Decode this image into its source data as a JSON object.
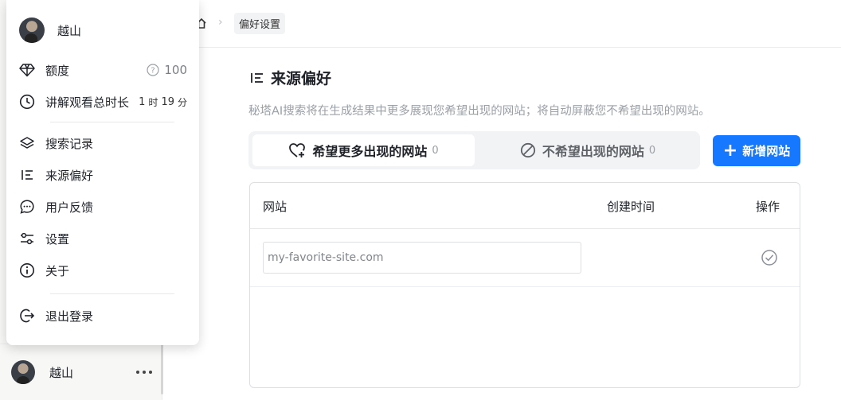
{
  "user": {
    "name": "越山"
  },
  "breadcrumb": {
    "current": "偏好设置"
  },
  "menu": {
    "quota": {
      "label": "额度",
      "value": "100"
    },
    "duration": {
      "label": "讲解观看总时长",
      "hours": "1",
      "hours_unit": "时",
      "minutes": "19",
      "minutes_unit": "分"
    },
    "items": [
      {
        "label": "搜索记录",
        "icon": "layers-icon"
      },
      {
        "label": "来源偏好",
        "icon": "list-filter-icon"
      },
      {
        "label": "用户反馈",
        "icon": "chat-bubble-icon"
      },
      {
        "label": "设置",
        "icon": "sliders-icon"
      },
      {
        "label": "关于",
        "icon": "info-icon"
      }
    ],
    "logout": {
      "label": "退出登录",
      "icon": "logout-icon"
    }
  },
  "page": {
    "title": "来源偏好",
    "description": "秘塔AI搜索将在生成结果中更多展现您希望出现的网站；将自动屏蔽您不希望出现的网站。",
    "tabs": [
      {
        "label": "希望更多出现的网站",
        "count": "0",
        "active": true
      },
      {
        "label": "不希望出现的网站",
        "count": "0",
        "active": false
      }
    ],
    "add_button": "新增网站",
    "table": {
      "headers": {
        "site": "网站",
        "created": "创建时间",
        "action": "操作"
      },
      "input_placeholder": "my-favorite-site.com"
    }
  },
  "colors": {
    "accent": "#1677ff",
    "muted": "#9aa0a6"
  }
}
